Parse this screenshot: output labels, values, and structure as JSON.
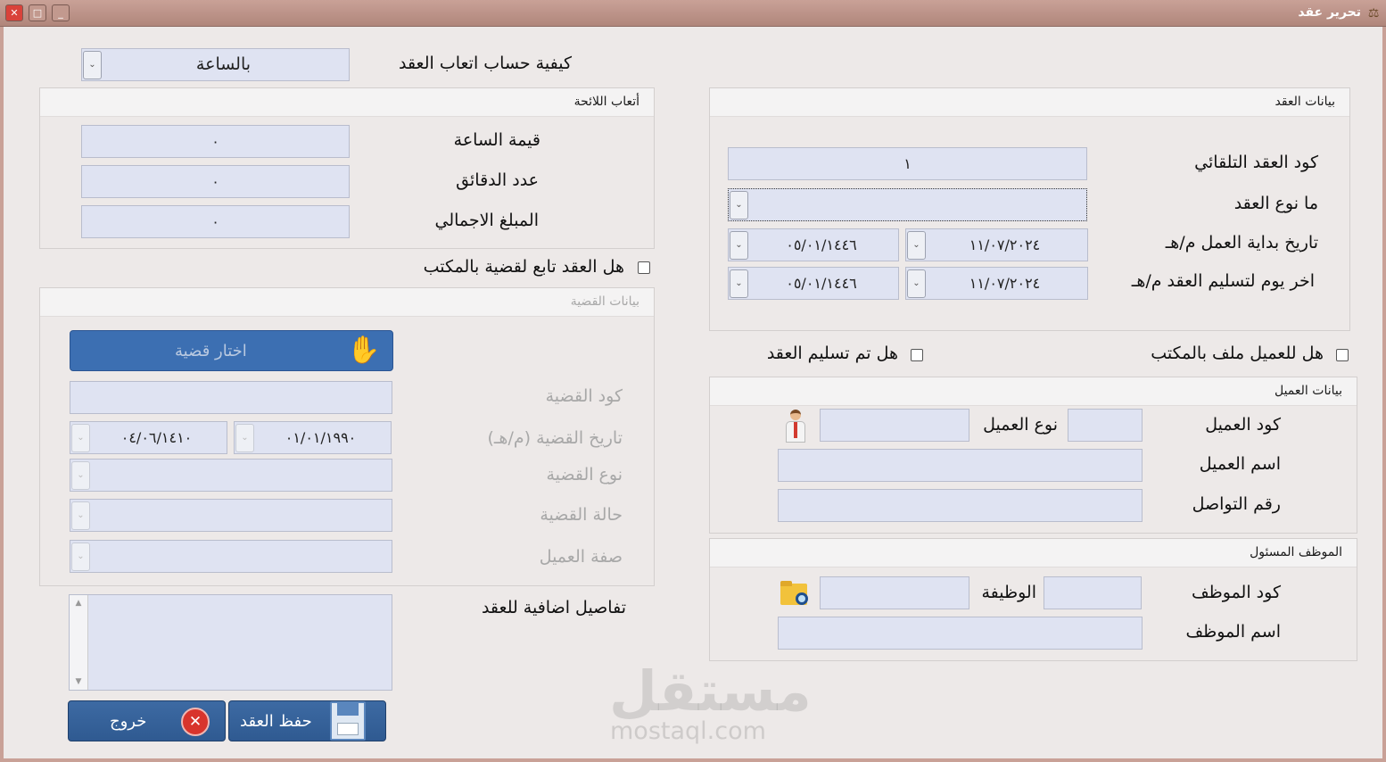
{
  "window": {
    "title": "تحرير عقد"
  },
  "fee_calc": {
    "label": "كيفية حساب اتعاب العقد",
    "value": "بالساعة"
  },
  "regulation_fees": {
    "title": "أتعاب اللائحة",
    "hour_value_label": "قيمة الساعة",
    "hour_value": "٠",
    "minutes_label": "عدد الدقائق",
    "minutes": "٠",
    "total_label": "المبلغ الاجمالي",
    "total": "٠"
  },
  "case_link": {
    "label": "هل العقد تابع لقضية بالمكتب"
  },
  "case_data": {
    "title": "بيانات القضية",
    "choose_button": "اختار قضية",
    "code_label": "كود القضية",
    "date_label": "تاريخ القضية (م/هـ)",
    "date_g": "٠١/٠١/١٩٩٠",
    "date_h": "٠٤/٠٦/١٤١٠",
    "type_label": "نوع القضية",
    "status_label": "حالة القضية",
    "client_role_label": "صفة العميل"
  },
  "extra": {
    "label": "تفاصيل اضافية للعقد"
  },
  "contract_data": {
    "title": "بيانات العقد",
    "auto_code_label": "كود العقد التلقائي",
    "auto_code": "١",
    "type_label": "ما نوع العقد",
    "start_label": "تاريخ بداية العمل م/هـ",
    "start_g": "١١/٠٧/٢٠٢٤",
    "start_h": "٠٥/٠١/١٤٤٦",
    "end_label": "اخر يوم لتسليم العقد م/هـ",
    "end_g": "١١/٠٧/٢٠٢٤",
    "end_h": "٠٥/٠١/١٤٤٦"
  },
  "checks": {
    "client_file": "هل للعميل ملف بالمكتب",
    "delivered": "هل تم تسليم العقد"
  },
  "client_data": {
    "title": "بيانات العميل",
    "code_label": "كود العميل",
    "type_label": "نوع العميل",
    "name_label": "اسم العميل",
    "phone_label": "رقم التواصل"
  },
  "employee": {
    "title": "الموظف المسئول",
    "code_label": "كود الموظف",
    "job_label": "الوظيفة",
    "name_label": "اسم الموظف"
  },
  "actions": {
    "save": "حفظ العقد",
    "exit": "خروج"
  },
  "watermark": {
    "arabic": "مستقل",
    "latin": "mostaql.com"
  }
}
